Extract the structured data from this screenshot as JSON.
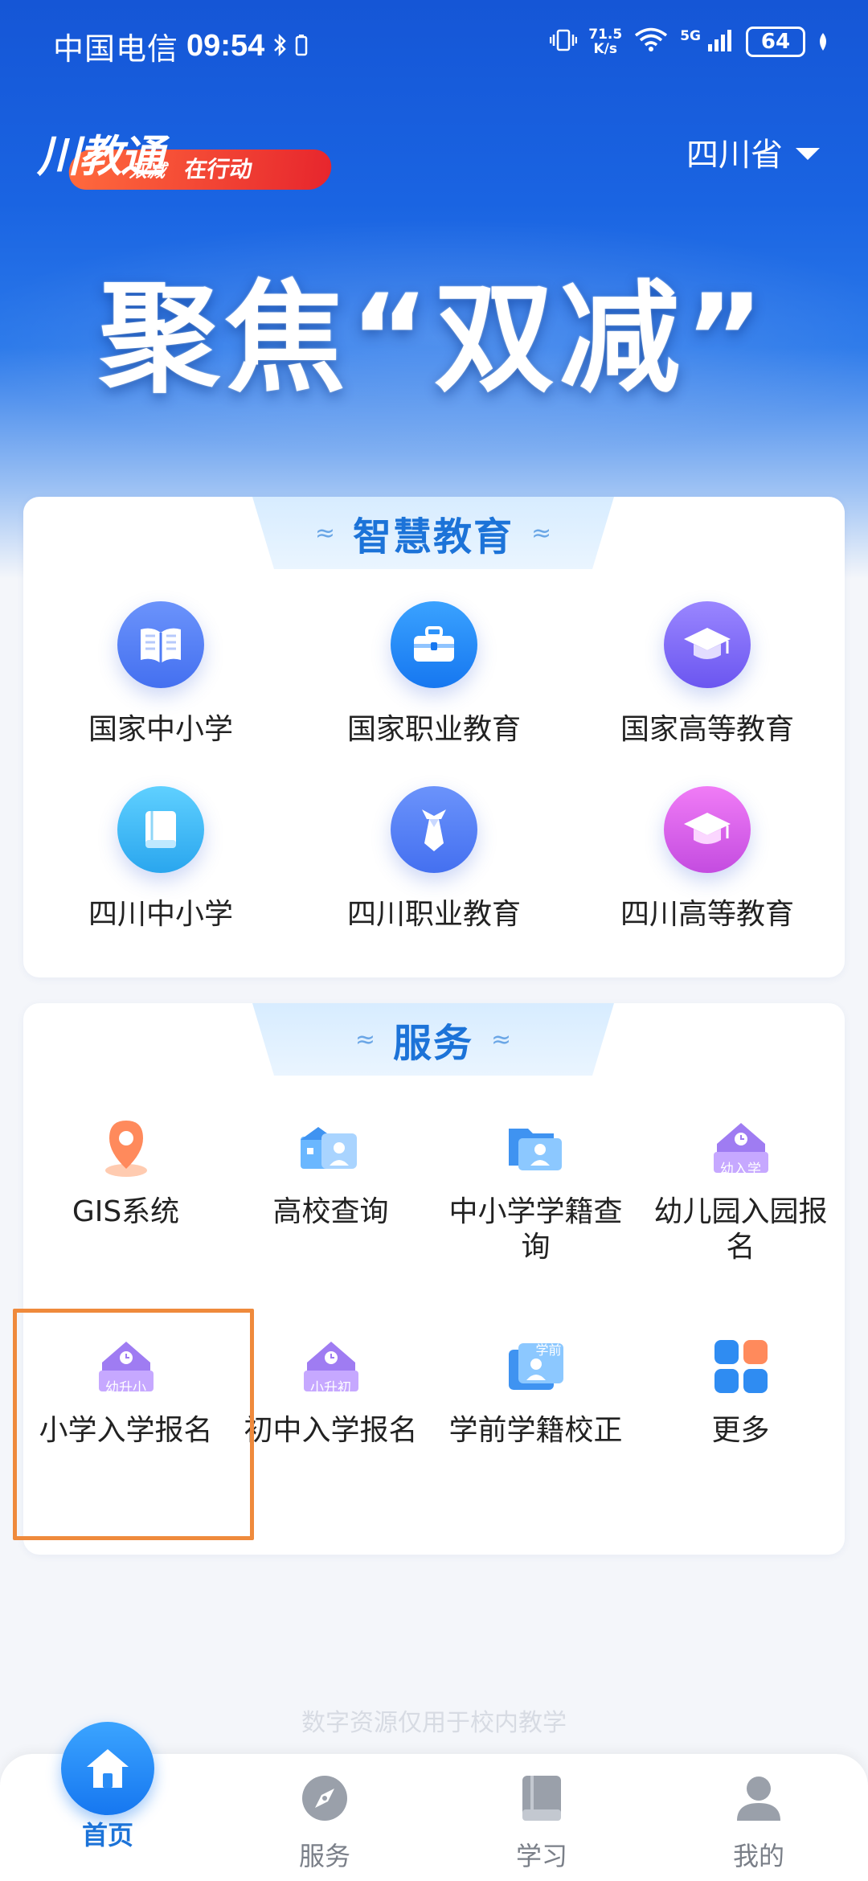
{
  "status_bar": {
    "carrier": "中国电信",
    "time": "09:54",
    "net_speed_value": "71.5",
    "net_speed_unit": "K/s",
    "network": "5G",
    "battery": "64"
  },
  "header": {
    "logo_main": "川教通",
    "logo_sub": "双减",
    "logo_tagline": "在行动",
    "province": "四川省",
    "slogan": "聚焦“双减”"
  },
  "edu_section": {
    "title": "智慧教育",
    "items": [
      {
        "label": "国家中小学",
        "icon": "book-open-icon",
        "color": "#4f7cf6"
      },
      {
        "label": "国家职业教育",
        "icon": "briefcase-icon",
        "color": "#1f8bf2"
      },
      {
        "label": "国家高等教育",
        "icon": "graduation-cap-icon",
        "color": "#7d6cf5"
      },
      {
        "label": "四川中小学",
        "icon": "book-icon",
        "color": "#3cb8f2"
      },
      {
        "label": "四川职业教育",
        "icon": "tie-icon",
        "color": "#4f7cf6"
      },
      {
        "label": "四川高等教育",
        "icon": "graduation-cap-icon",
        "color": "#dd62e6"
      }
    ]
  },
  "service_section": {
    "title": "服务",
    "items": [
      {
        "label": "GIS系统",
        "icon": "location-pin-icon"
      },
      {
        "label": "高校查询",
        "icon": "campus-search-icon"
      },
      {
        "label": "中小学学籍查询",
        "icon": "student-folder-icon"
      },
      {
        "label": "幼儿园入园报名",
        "icon": "house-badge-icon",
        "badge": "幼入学"
      },
      {
        "label": "小学入学报名",
        "icon": "house-badge-icon",
        "badge": "幼升小"
      },
      {
        "label": "初中入学报名",
        "icon": "house-badge-icon",
        "badge": "小升初"
      },
      {
        "label": "学前学籍校正",
        "icon": "student-card-icon",
        "badge": "学前"
      },
      {
        "label": "更多",
        "icon": "grid-more-icon"
      }
    ]
  },
  "footnote": "数字资源仅用于校内教学",
  "bottom_nav": {
    "items": [
      {
        "label": "首页",
        "icon": "home-icon",
        "active": true
      },
      {
        "label": "服务",
        "icon": "compass-icon",
        "active": false
      },
      {
        "label": "学习",
        "icon": "book-icon",
        "active": false
      },
      {
        "label": "我的",
        "icon": "user-icon",
        "active": false
      }
    ]
  },
  "colors": {
    "primary": "#1c73d8",
    "highlight_border": "#ef8a3c",
    "header_blue": "#1a64e2"
  }
}
